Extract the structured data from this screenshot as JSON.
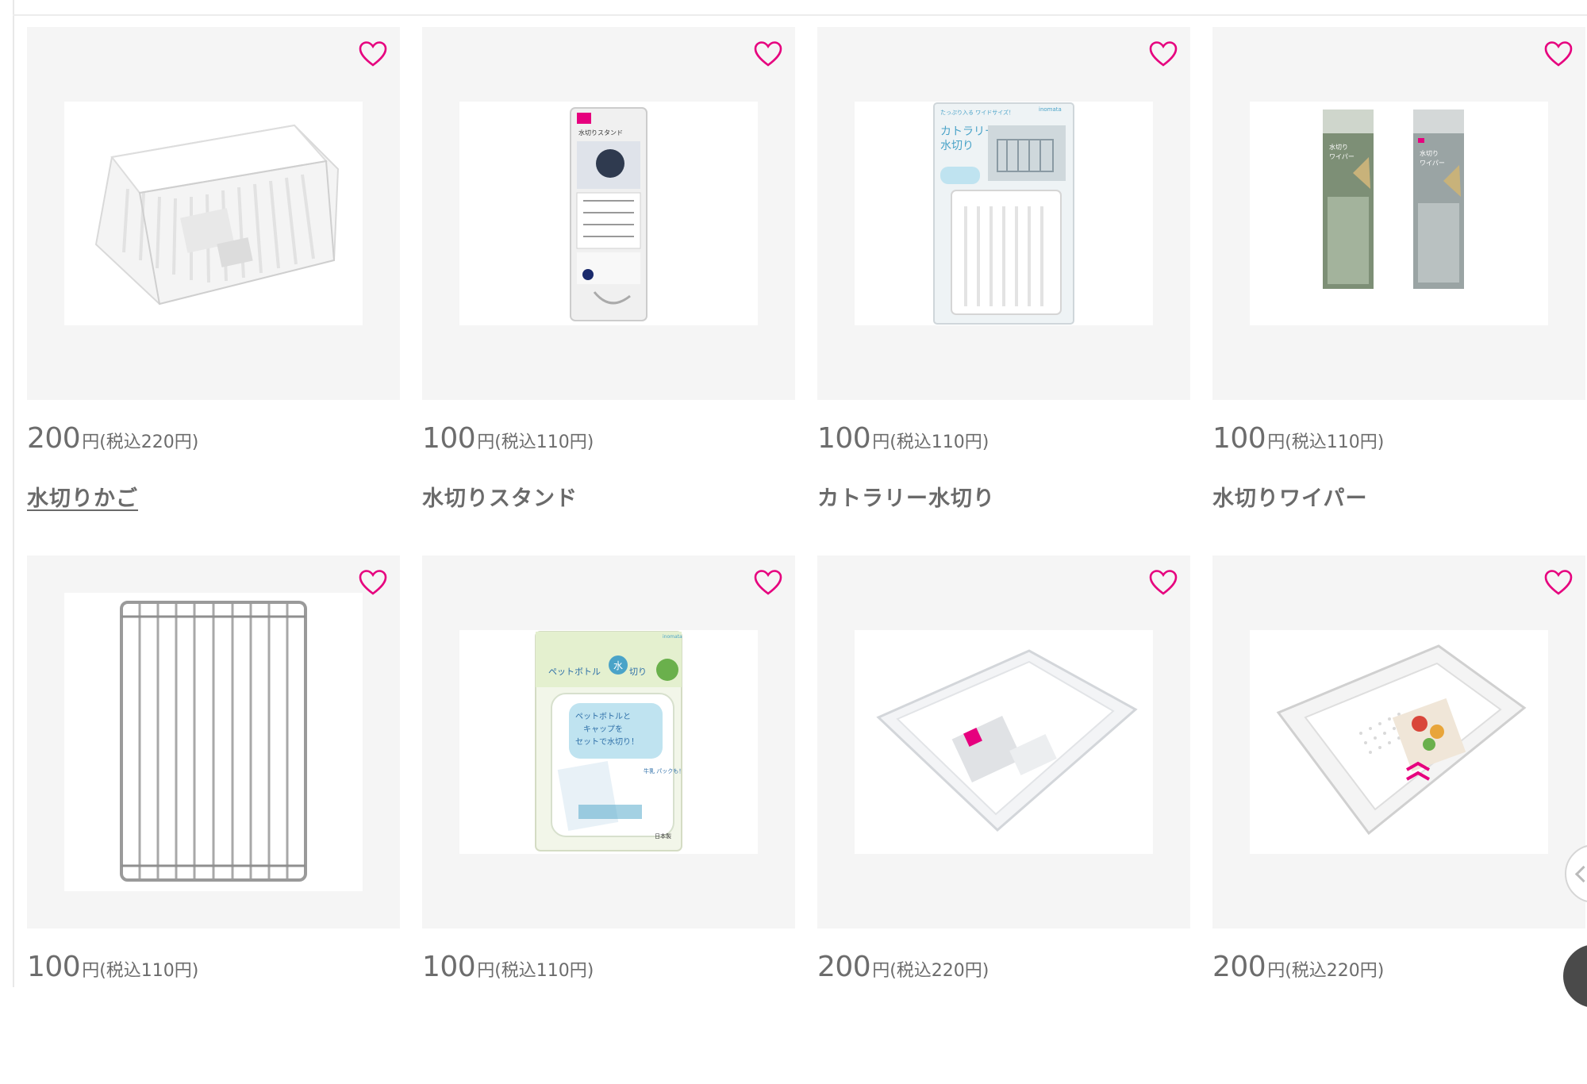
{
  "colors": {
    "accent_heart": "#e6007e",
    "card_bg": "#f5f5f5",
    "text": "#6a6a6a"
  },
  "products": [
    {
      "price": "200",
      "tax": "円(税込220円)",
      "name": "水切りかご",
      "icon": "dish-drainer-basket"
    },
    {
      "price": "100",
      "tax": "円(税込110円)",
      "name": "水切りスタンド",
      "icon": "drainer-stand-package"
    },
    {
      "price": "100",
      "tax": "円(税込110円)",
      "name": "カトラリー水切り",
      "icon": "cutlery-drainer-package"
    },
    {
      "price": "100",
      "tax": "円(税込110円)",
      "name": "水切りワイパー",
      "icon": "drain-wiper-packages"
    },
    {
      "price": "100",
      "tax": "円(税込110円)",
      "name": "",
      "icon": "wire-rack"
    },
    {
      "price": "100",
      "tax": "円(税込110円)",
      "name": "",
      "icon": "pet-bottle-drainer-package"
    },
    {
      "price": "200",
      "tax": "円(税込220円)",
      "name": "",
      "icon": "white-tray"
    },
    {
      "price": "200",
      "tax": "円(税込220円)",
      "name": "",
      "icon": "colander-basket"
    }
  ],
  "images": {
    "stand_package": {
      "label": "水切りスタンド"
    },
    "cutlery_package": {
      "label1": "カトラリー",
      "label2": "水切り",
      "top": "たっぷり入る ワイドサイズ！",
      "brand": "inomata"
    },
    "wiper": {
      "label1": "水切り",
      "label2": "ワイパー"
    },
    "pet_bottle": {
      "title1": "ペットボトル",
      "title2": "水",
      "title3": "切り",
      "line1": "ペットボトルと",
      "line2": "キャップを",
      "line3": "セットで水切り！",
      "badge": "牛乳 パックも！",
      "bottom": "日本製",
      "brand": "inomata"
    }
  }
}
